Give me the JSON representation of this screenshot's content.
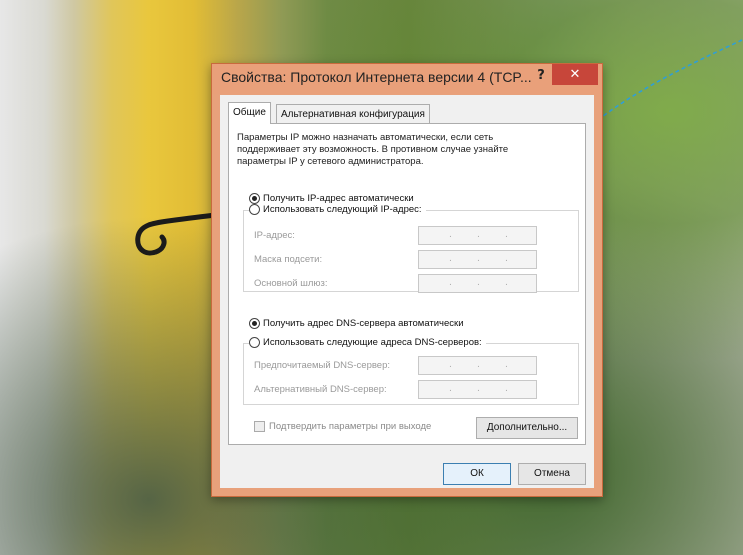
{
  "window": {
    "title": "Свойства: Протокол Интернета версии 4 (TCP...",
    "help_label": "?",
    "close_label": "✕"
  },
  "tabs": [
    {
      "label": "Общие"
    },
    {
      "label": "Альтернативная конфигурация"
    }
  ],
  "description": "Параметры IP можно назначать автоматически, если сеть поддерживает эту возможность. В противном случае узнайте параметры IP у сетевого администратора.",
  "ip": {
    "auto_label": "Получить IP-адрес автоматически",
    "manual_label": "Использовать следующий IP-адрес:",
    "fields": [
      {
        "label": "IP-адрес:"
      },
      {
        "label": "Маска подсети:"
      },
      {
        "label": "Основной шлюз:"
      }
    ]
  },
  "dns": {
    "auto_label": "Получить адрес DNS-сервера автоматически",
    "manual_label": "Использовать следующие адреса DNS-серверов:",
    "fields": [
      {
        "label": "Предпочитаемый DNS-сервер:"
      },
      {
        "label": "Альтернативный DNS-сервер:"
      }
    ]
  },
  "confirm_label": "Подтвердить параметры при выходе",
  "buttons": {
    "advanced": "Дополнительно...",
    "ok": "ОК",
    "cancel": "Отмена"
  },
  "colors": {
    "window_frame": "#e9a07a",
    "close_button": "#c7463a",
    "arrow": "#2f9fd6"
  }
}
